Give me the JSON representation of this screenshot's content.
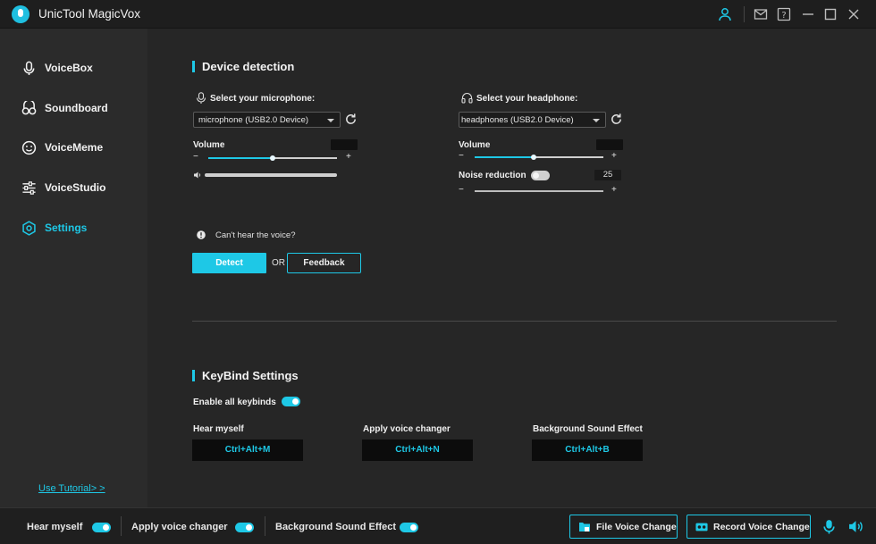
{
  "app": {
    "title": "UnicTool MagicVox"
  },
  "sidebar": {
    "items": [
      {
        "label": "VoiceBox",
        "icon": "microphone-icon"
      },
      {
        "label": "Soundboard",
        "icon": "soundboard-icon"
      },
      {
        "label": "VoiceMeme",
        "icon": "smiley-icon"
      },
      {
        "label": "VoiceStudio",
        "icon": "sliders-icon"
      },
      {
        "label": "Settings",
        "icon": "gear-icon",
        "active": true
      }
    ],
    "tutorial_link": "Use Tutorial> >"
  },
  "device": {
    "title": "Device detection",
    "mic": {
      "label": "Select your microphone:",
      "value": "microphone (USB2.0 Device)",
      "volume_label": "Volume",
      "volume_level": 0.5,
      "minus": "−",
      "plus": "+"
    },
    "headphone": {
      "label": "Select your headphone:",
      "value": "headphones (USB2.0 Device)",
      "volume_label": "Volume",
      "volume_level": 0.46,
      "noise_label": "Noise reduction",
      "noise_value": "25",
      "minus": "−",
      "plus": "+"
    },
    "help_text": "Can't hear the voice?",
    "detect_label": "Detect",
    "or_label": "OR",
    "feedback_label": "Feedback"
  },
  "keybind": {
    "title": "KeyBind Settings",
    "enable_label": "Enable all keybinds",
    "items": [
      {
        "label": "Hear myself",
        "key": "Ctrl+Alt+M"
      },
      {
        "label": "Apply voice changer",
        "key": "Ctrl+Alt+N"
      },
      {
        "label": "Background Sound Effect",
        "key": "Ctrl+Alt+B"
      }
    ]
  },
  "bottombar": {
    "hear_myself": "Hear myself",
    "apply_voice": "Apply voice changer",
    "background_effect": "Background Sound Effect",
    "file_voice_change": "File Voice Change",
    "record_voice_change": "Record Voice Change"
  },
  "colors": {
    "accent": "#1ec8e6",
    "background": "#262626",
    "sidebar": "#2b2b2b"
  }
}
